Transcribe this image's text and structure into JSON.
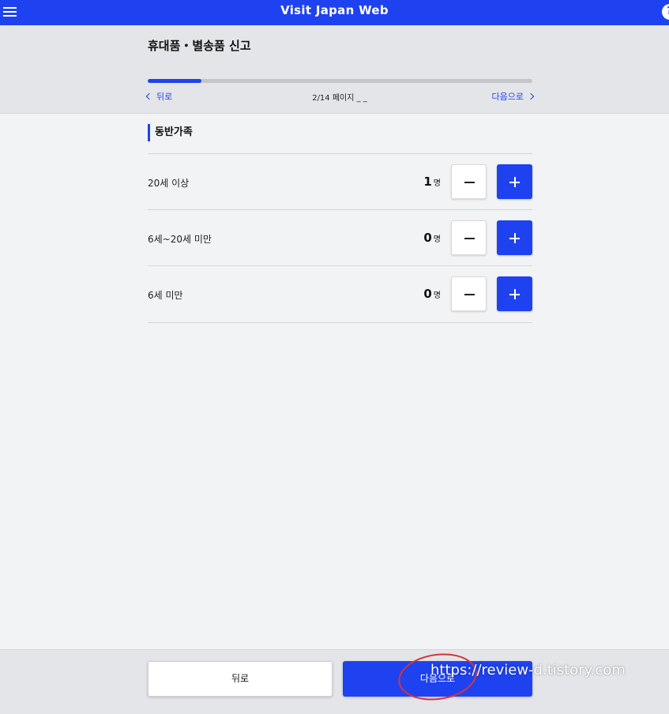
{
  "app": {
    "title": "Visit Japan Web"
  },
  "header": {
    "title": "휴대품・별송품 신고",
    "progress_fraction": 0.14,
    "back_label": "뒤로",
    "page_indicator": "2/14 페이지 _ _",
    "next_label": "다음으로"
  },
  "section": {
    "title": "동반가족",
    "rows": [
      {
        "label": "20세 이상",
        "count": "1",
        "unit": "명"
      },
      {
        "label": "6세~20세 미만",
        "count": "0",
        "unit": "명"
      },
      {
        "label": "6세 미만",
        "count": "0",
        "unit": "명"
      }
    ]
  },
  "footer": {
    "back_label": "뒤로",
    "next_label": "다음으로"
  },
  "watermark": "https://review-d.tistory.com",
  "icons": {
    "menu": "hamburger-menu-icon",
    "help": "help-icon",
    "minus": "minus-icon",
    "plus": "plus-icon"
  },
  "colors": {
    "accent": "#1f42f0",
    "annotation": "#d4343a"
  }
}
